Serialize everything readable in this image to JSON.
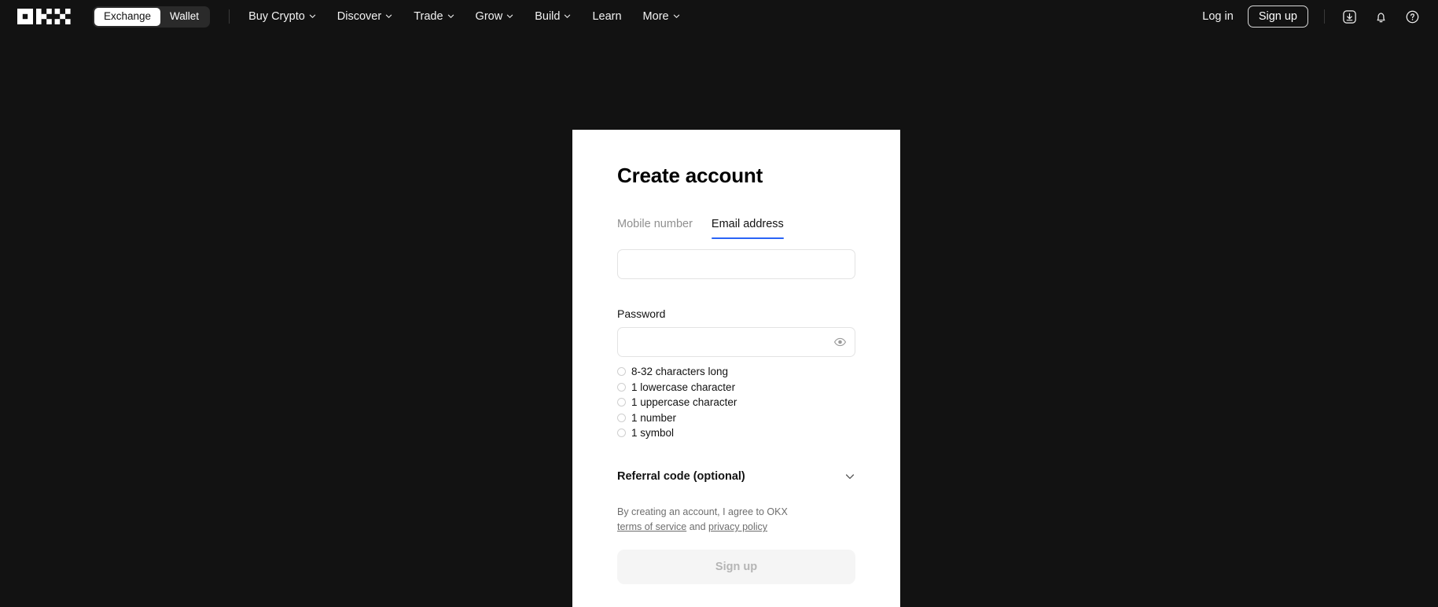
{
  "nav": {
    "logo_name": "okx-logo",
    "toggle": [
      {
        "label": "Exchange",
        "active": true
      },
      {
        "label": "Wallet",
        "active": false
      }
    ],
    "links": [
      {
        "label": "Buy Crypto",
        "caret": true
      },
      {
        "label": "Discover",
        "caret": true
      },
      {
        "label": "Trade",
        "caret": true
      },
      {
        "label": "Grow",
        "caret": true
      },
      {
        "label": "Build",
        "caret": true
      },
      {
        "label": "Learn",
        "caret": false
      },
      {
        "label": "More",
        "caret": true
      }
    ],
    "login_label": "Log in",
    "signup_label": "Sign up",
    "icons": [
      {
        "name": "download-icon"
      },
      {
        "name": "bell-icon"
      },
      {
        "name": "help-circle-icon"
      }
    ]
  },
  "card": {
    "title": "Create account",
    "tabs": [
      {
        "label": "Mobile number",
        "active": false
      },
      {
        "label": "Email address",
        "active": true
      }
    ],
    "email": {
      "value": "",
      "placeholder": ""
    },
    "password": {
      "label": "Password",
      "value": "",
      "placeholder": "",
      "toggle_icon": "eye-icon"
    },
    "requirements": [
      "8-32 characters long",
      "1 lowercase character",
      "1 uppercase character",
      "1 number",
      "1 symbol"
    ],
    "referral": {
      "label": "Referral code (optional)",
      "chevron_icon": "chevron-down-icon"
    },
    "terms": {
      "prefix": "By creating an account, I agree to OKX ",
      "link1": "terms of service",
      "middle": " and ",
      "link2": "privacy policy"
    },
    "submit_label": "Sign up"
  },
  "colors": {
    "page_bg": "#121212",
    "card_bg": "#ffffff",
    "accent": "#2a64f6",
    "muted_text": "#8f8f8f",
    "disabled_btn_bg": "#f5f5f5"
  }
}
